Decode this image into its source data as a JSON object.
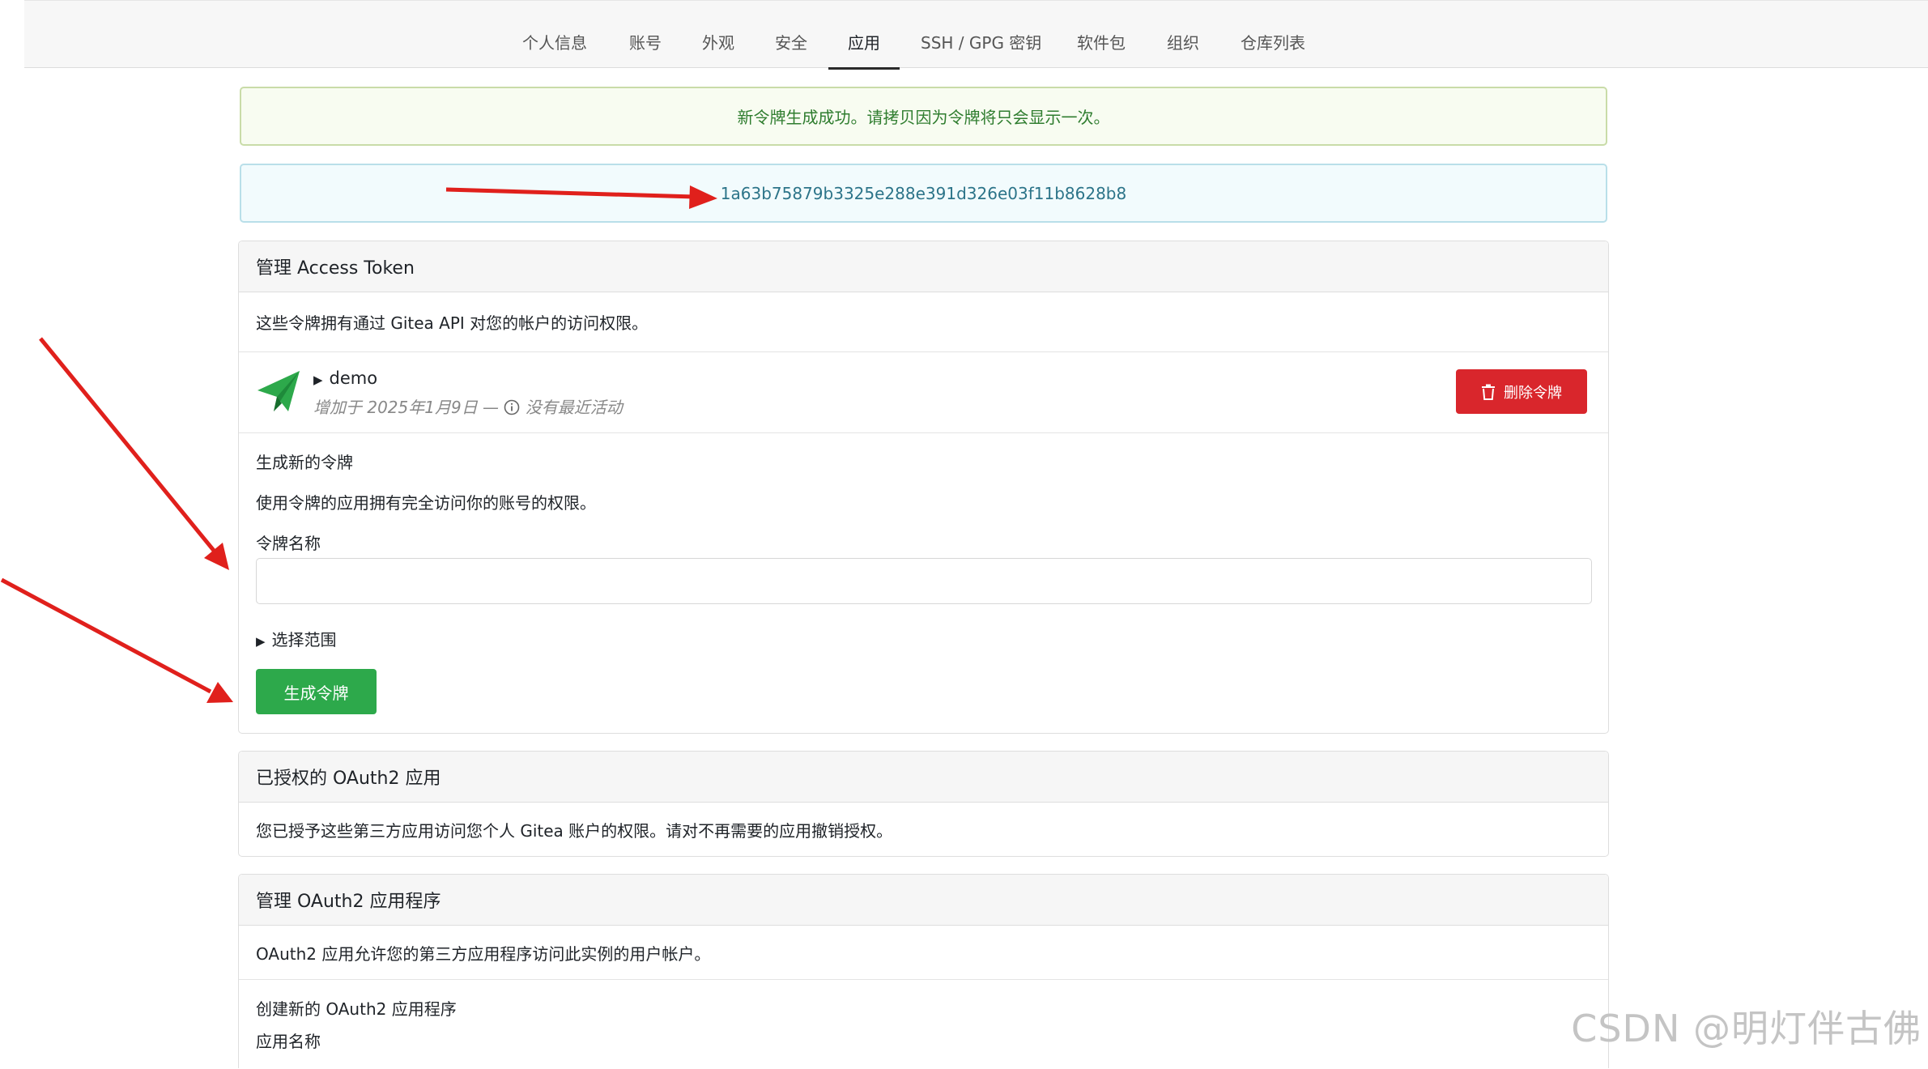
{
  "nav": {
    "tabs": [
      {
        "label": "个人信息",
        "active": false
      },
      {
        "label": "账号",
        "active": false
      },
      {
        "label": "外观",
        "active": false
      },
      {
        "label": "安全",
        "active": false
      },
      {
        "label": "应用",
        "active": true
      },
      {
        "label": "SSH / GPG 密钥",
        "active": false
      },
      {
        "label": "软件包",
        "active": false
      },
      {
        "label": "组织",
        "active": false
      },
      {
        "label": "仓库列表",
        "active": false
      }
    ]
  },
  "flash": {
    "success": "新令牌生成成功。请拷贝因为令牌将只会显示一次。",
    "token_value": "1a63b75879b3325e288e391d326e03f11b8628b8"
  },
  "access_token": {
    "header": "管理 Access Token",
    "description": "这些令牌拥有通过 Gitea API 对您的帐户的访问权限。",
    "token": {
      "name": "demo",
      "added": "增加于 2025年1月9日 —",
      "activity": "没有最近活动",
      "delete_label": "删除令牌"
    },
    "form": {
      "title": "生成新的令牌",
      "hint": "使用令牌的应用拥有完全访问你的账号的权限。",
      "name_label": "令牌名称",
      "name_value": "",
      "scope_toggle": "选择范围",
      "submit_label": "生成令牌"
    }
  },
  "oauth_grants": {
    "header": "已授权的 OAuth2 应用",
    "description": "您已授予这些第三方应用访问您个人 Gitea 账户的权限。请对不再需要的应用撤销授权。"
  },
  "oauth_apps": {
    "header": "管理 OAuth2 应用程序",
    "description": "OAuth2 应用允许您的第三方应用程序访问此实例的用户帐户。",
    "create_title": "创建新的 OAuth2 应用程序",
    "app_name_label": "应用名称"
  },
  "watermark": "CSDN @明灯伴古佛",
  "colors": {
    "success_bg": "#f8fcf1",
    "success_text": "#2f7d2f",
    "token_bg": "#f2fbfd",
    "token_text": "#2c7489",
    "danger": "#d9262c",
    "primary_green": "#2da94b",
    "annotation_arrow": "#e0201c"
  }
}
